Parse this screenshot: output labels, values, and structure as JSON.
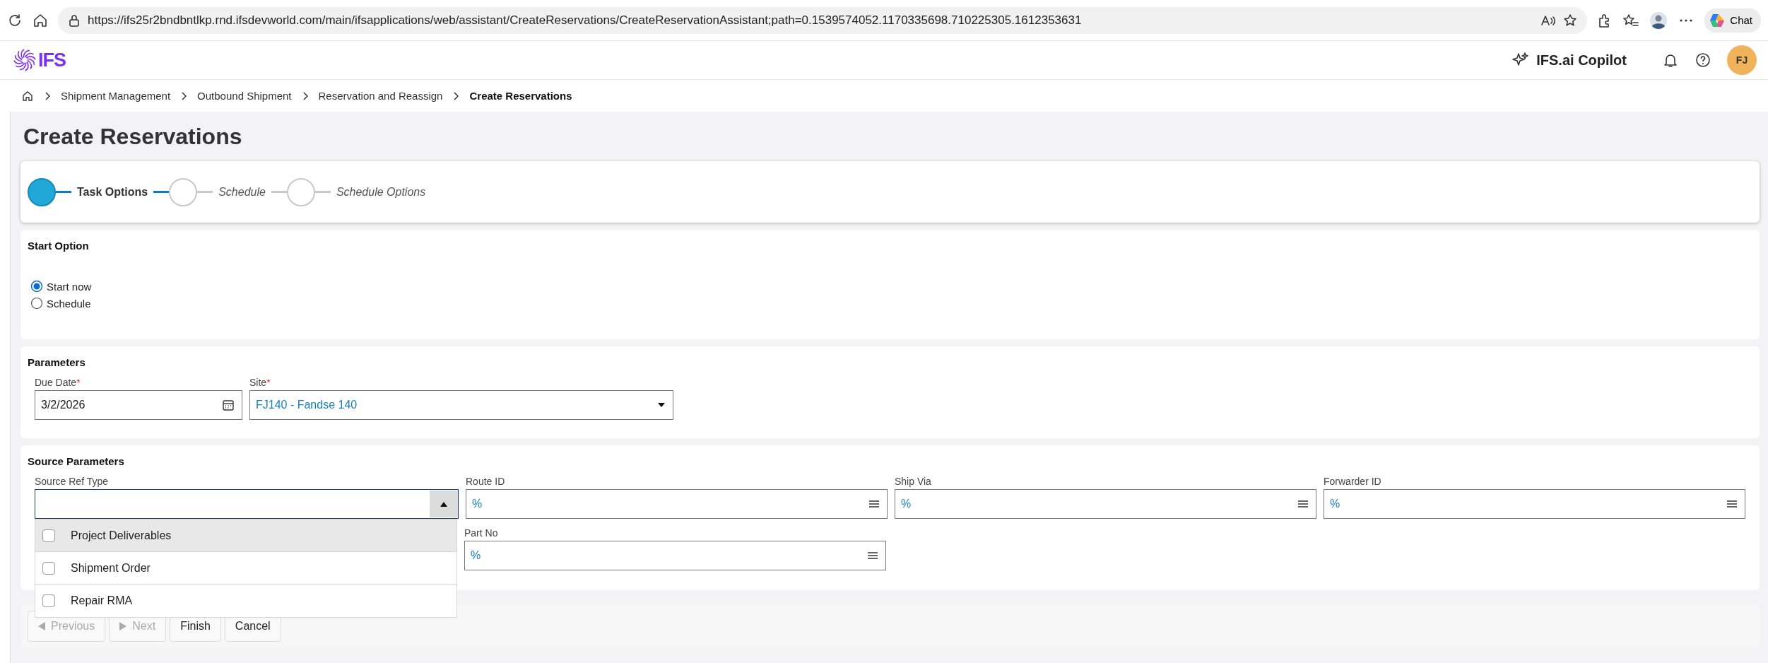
{
  "browser": {
    "url": "https://ifs25r2bndbntlkp.rnd.ifsdevworld.com/main/ifsapplications/web/assistant/CreateReservations/CreateReservationAssistant;path=0.1539574052.1170335698.710225305.1612353631",
    "chat": "Chat"
  },
  "header": {
    "logo": "IFS",
    "copilot": "IFS.ai Copilot",
    "avatar": "FJ"
  },
  "breadcrumb": [
    {
      "label": "Shipment Management",
      "current": false
    },
    {
      "label": "Outbound Shipment",
      "current": false
    },
    {
      "label": "Reservation and Reassign",
      "current": false
    },
    {
      "label": "Create Reservations",
      "current": true
    }
  ],
  "title": "Create Reservations",
  "steps": [
    {
      "label": "Task Options",
      "selected": true
    },
    {
      "label": "Schedule",
      "selected": false
    },
    {
      "label": "Schedule Options",
      "selected": false
    }
  ],
  "start_option": {
    "title": "Start Option",
    "options": [
      {
        "label": "Start now",
        "selected": true
      },
      {
        "label": "Schedule",
        "selected": false
      }
    ]
  },
  "parameters": {
    "title": "Parameters",
    "fields": [
      {
        "label": "Due Date",
        "required_mark": "*",
        "value": "3/2/2026",
        "kind": "date"
      },
      {
        "label": "Site",
        "required_mark": "*",
        "value": "FJ140 - Fandse 140",
        "kind": "select"
      }
    ]
  },
  "source_parameters": {
    "title": "Source Parameters",
    "fields": [
      {
        "label": "Source Ref Type",
        "kind": "multiselect",
        "expanded": true,
        "options": [
          {
            "label": "Project Deliverables",
            "checked": false,
            "highlighted": true
          },
          {
            "label": "Shipment Order",
            "checked": false,
            "highlighted": false
          },
          {
            "label": "Repair RMA",
            "checked": false,
            "highlighted": false
          }
        ]
      },
      {
        "label": "Route ID",
        "value": "%",
        "kind": "lov"
      },
      {
        "label": "Ship Via",
        "value": "%",
        "kind": "lov"
      },
      {
        "label": "Forwarder ID",
        "value": "%",
        "kind": "lov"
      },
      {
        "label": "Part No",
        "value": "%",
        "kind": "lov"
      }
    ]
  },
  "footer": {
    "buttons": [
      {
        "label": "Previous",
        "kind": "prev",
        "disabled": true
      },
      {
        "label": "Next",
        "kind": "next",
        "disabled": true
      },
      {
        "label": "Finish",
        "kind": "plain",
        "disabled": false
      },
      {
        "label": "Cancel",
        "kind": "plain",
        "disabled": false
      }
    ]
  }
}
